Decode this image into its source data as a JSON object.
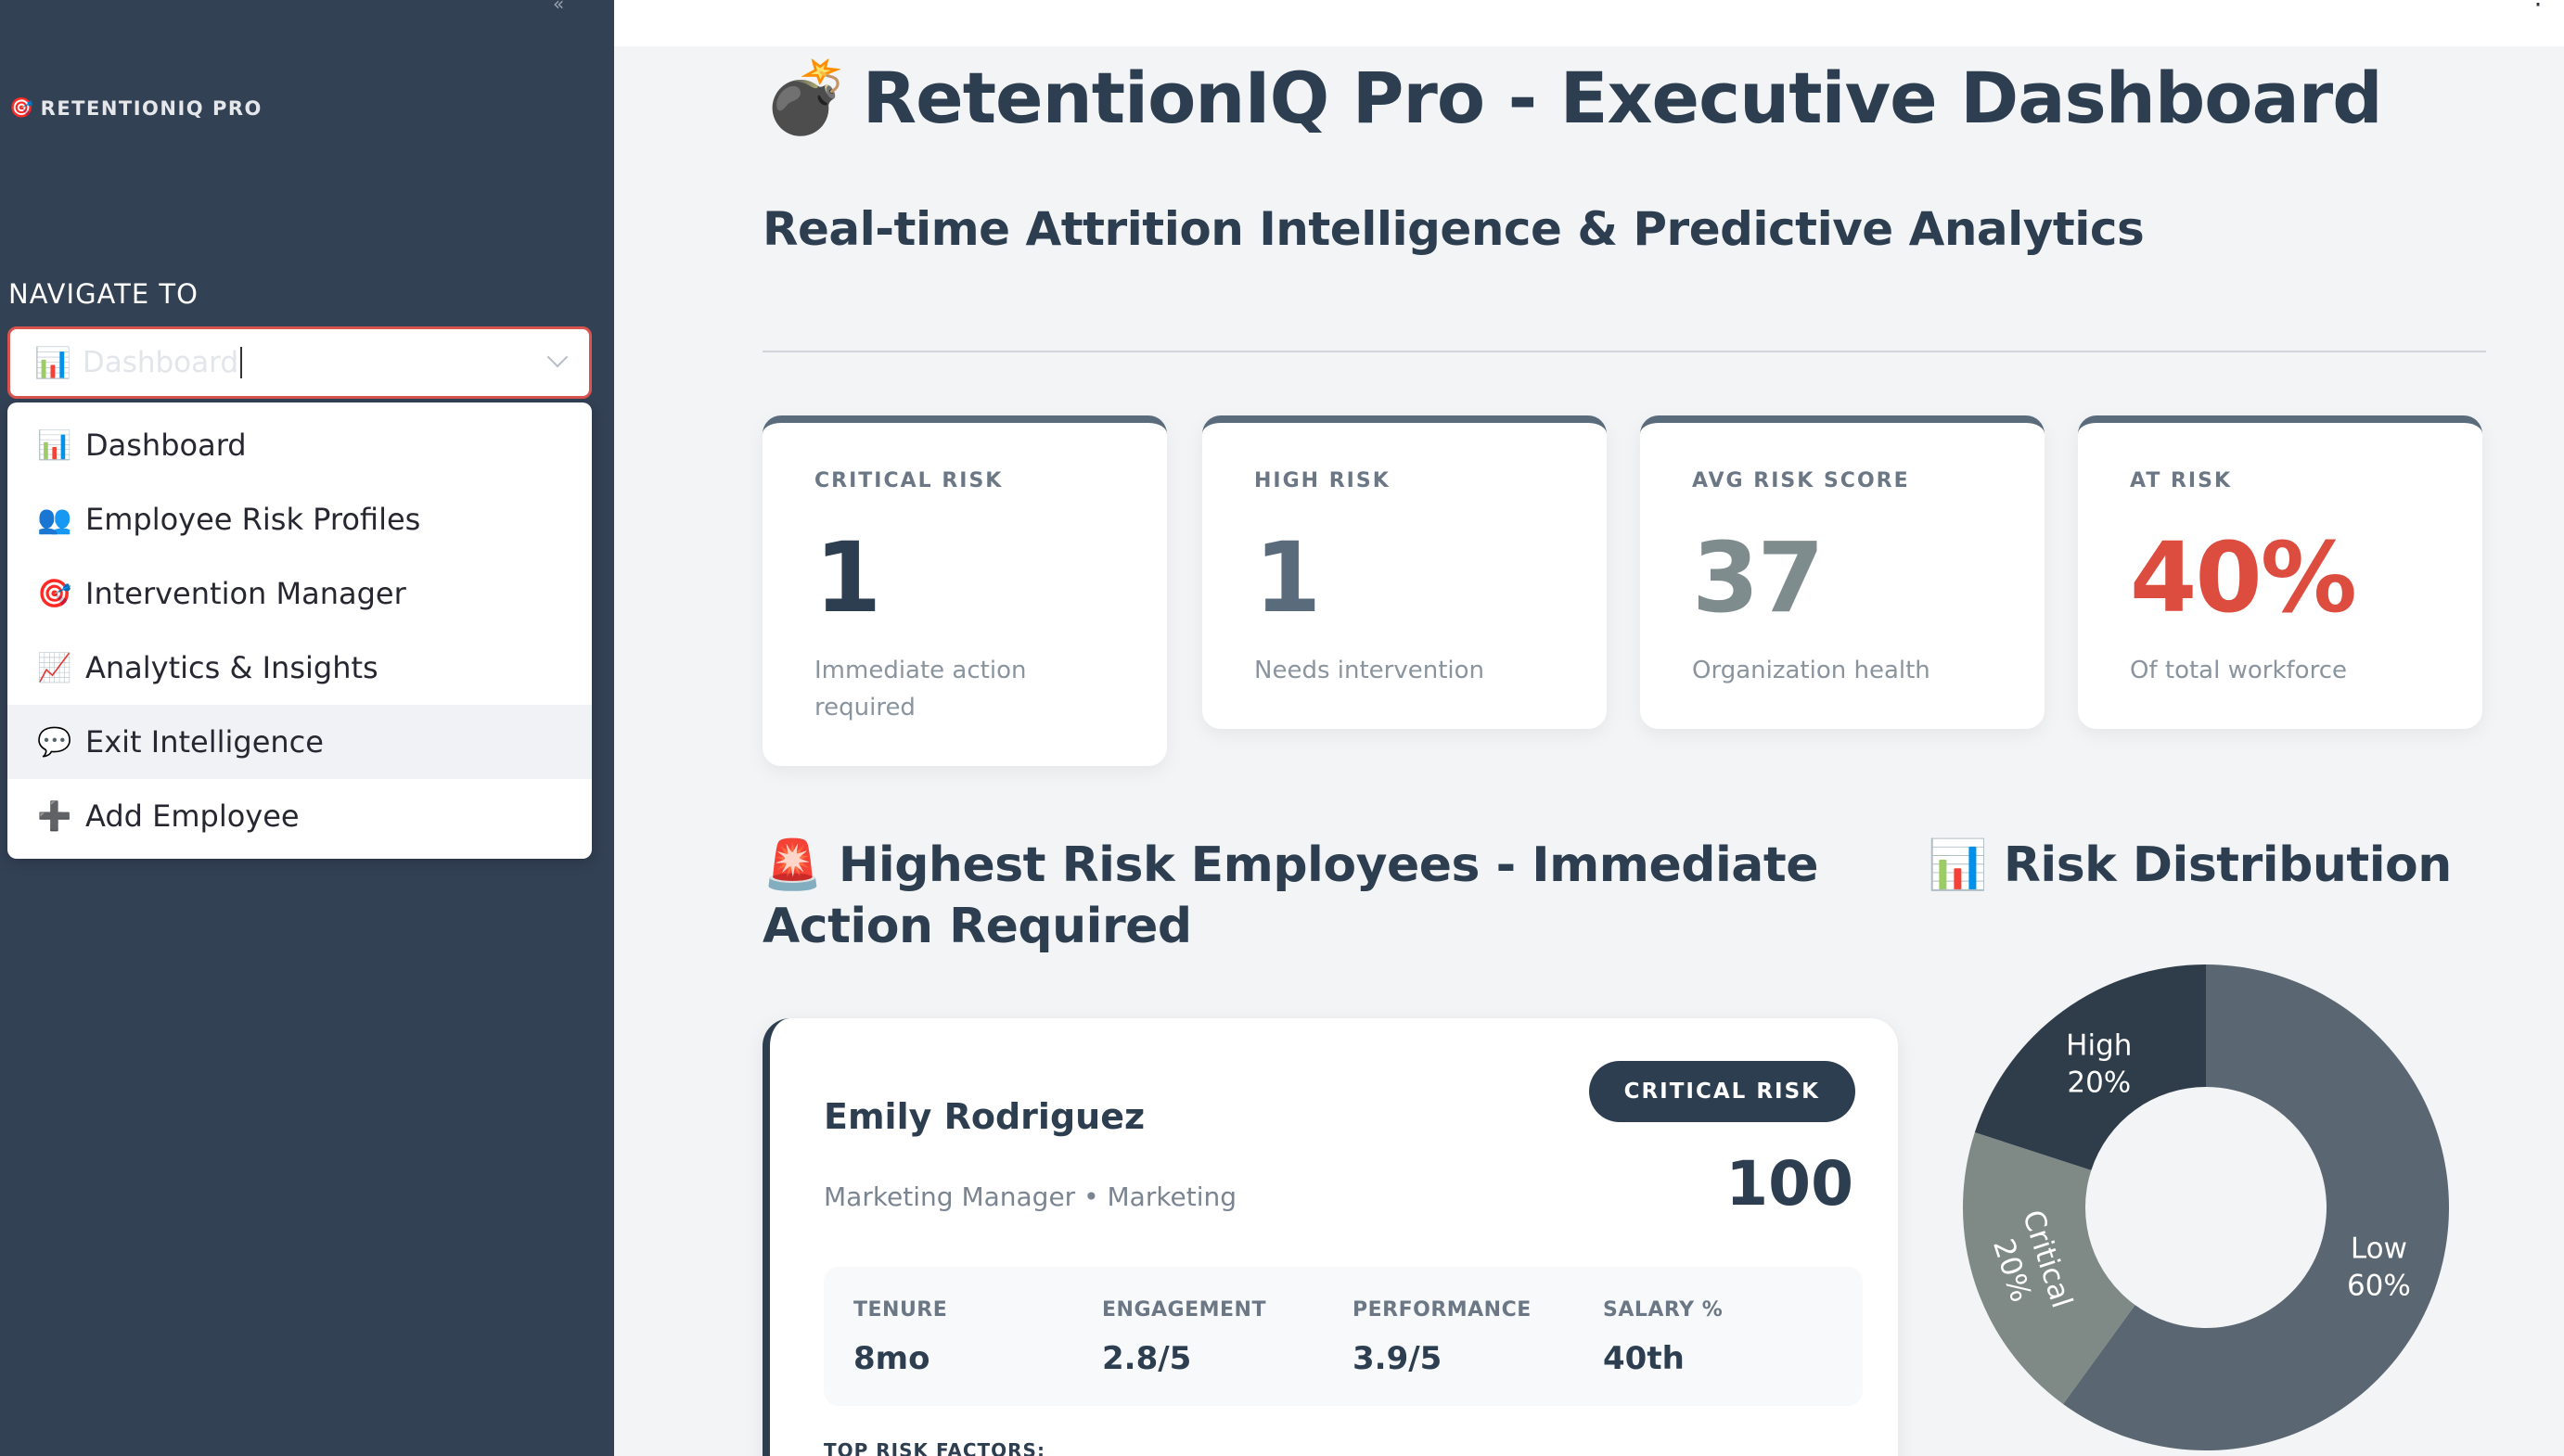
{
  "sidebar": {
    "brand_icon": "🎯",
    "brand": "RETENTIONIQ PRO",
    "nav_label": "NAVIGATE TO",
    "select": {
      "icon": "📊",
      "value": "Dashboard"
    },
    "menu": [
      {
        "icon": "📊",
        "label": "Dashboard"
      },
      {
        "icon": "👥",
        "label": "Employee Risk Profiles"
      },
      {
        "icon": "🎯",
        "label": "Intervention Manager"
      },
      {
        "icon": "📈",
        "label": "Analytics & Insights"
      },
      {
        "icon": "💬",
        "label": "Exit Intelligence"
      },
      {
        "icon": "➕",
        "label": "Add Employee"
      }
    ]
  },
  "header": {
    "title_icon": "💣",
    "title": "RetentionIQ Pro - Executive Dashboard",
    "subtitle": "Real-time Attrition Intelligence & Predictive Analytics"
  },
  "metrics": [
    {
      "label": "CRITICAL RISK",
      "value": "1",
      "sub": "Immediate action required",
      "color": "#2d3e50"
    },
    {
      "label": "HIGH RISK",
      "value": "1",
      "sub": "Needs intervention",
      "color": "#5a6b7c"
    },
    {
      "label": "AVG RISK SCORE",
      "value": "37",
      "sub": "Organization health",
      "color": "#7f8c8d"
    },
    {
      "label": "AT RISK",
      "value": "40%",
      "sub": "Of total workforce",
      "color": "#dc4c3f"
    }
  ],
  "sections": {
    "highest_risk_icon": "🚨",
    "highest_risk": "Highest Risk Employees - Immediate Action Required",
    "distribution_icon": "📊",
    "distribution": "Risk Distribution"
  },
  "employee": {
    "name": "Emily Rodriguez",
    "role": "Marketing Manager • Marketing",
    "badge": "CRITICAL RISK",
    "score": "100",
    "stats": [
      {
        "label": "TENURE",
        "value": "8mo"
      },
      {
        "label": "ENGAGEMENT",
        "value": "2.8/5"
      },
      {
        "label": "PERFORMANCE",
        "value": "3.9/5"
      },
      {
        "label": "SALARY %",
        "value": "40th"
      }
    ],
    "factors_label": "TOP RISK FACTORS:"
  },
  "chart_data": {
    "type": "pie",
    "hole": true,
    "categories": [
      "Low",
      "Critical",
      "High"
    ],
    "values": [
      60,
      20,
      20
    ],
    "labels": [
      "60%",
      "20%",
      "20%"
    ],
    "colors": [
      "#5a6672",
      "#7f8a87",
      "#2f3c4a"
    ]
  }
}
